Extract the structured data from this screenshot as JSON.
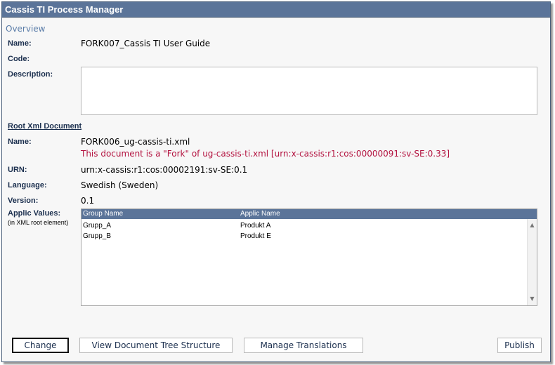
{
  "window": {
    "title": "Cassis TI Process Manager"
  },
  "overview": {
    "heading": "Overview"
  },
  "fields": {
    "name_label": "Name:",
    "name_value": "FORK007_Cassis TI User Guide",
    "code_label": "Code:",
    "code_value": "",
    "description_label": "Description:",
    "description_value": ""
  },
  "root": {
    "section_title": "Root Xml Document",
    "name_label": "Name:",
    "name_value": "FORK006_ug-cassis-ti.xml",
    "fork_note": "This document is a \"Fork\" of ug-cassis-ti.xml [urn:x-cassis:r1:cos:00000091:sv-SE:0.33]",
    "urn_label": "URN:",
    "urn_value": "urn:x-cassis:r1:cos:00002191:sv-SE:0.1",
    "language_label": "Language:",
    "language_value": "Swedish (Sweden)",
    "version_label": "Version:",
    "version_value": "0.1",
    "applic_label": "Applic Values:",
    "applic_sublabel": "(in XML root element)"
  },
  "applic_table": {
    "headers": [
      "Group Name",
      "Applic Name"
    ],
    "rows": [
      [
        "Grupp_A",
        "Produkt A"
      ],
      [
        "Grupp_B",
        "Produkt E"
      ]
    ]
  },
  "buttons": {
    "change": "Change",
    "view_tree": "View Document Tree Structure",
    "manage_translations": "Manage Translations",
    "publish": "Publish"
  },
  "colors": {
    "titlebar": "#5b7499",
    "label_text": "#1b2f4e",
    "fork_note": "#b3123f",
    "overview": "#5a7ca8"
  }
}
